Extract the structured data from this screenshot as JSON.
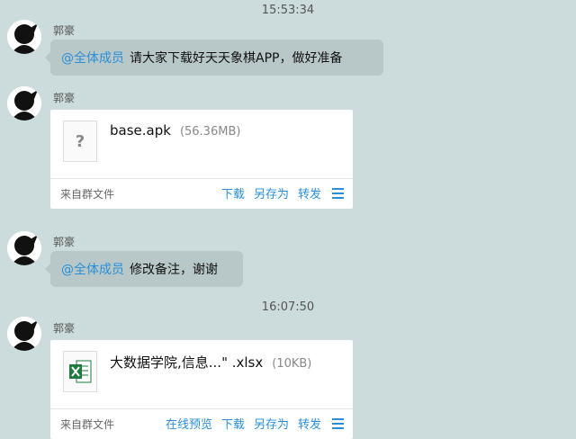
{
  "timestamps": [
    "15:53:34",
    "16:07:50"
  ],
  "messages": [
    {
      "sender": "郭豪",
      "mention": "@全体成员",
      "text": "请大家下载好天天象棋APP，做好准备"
    },
    {
      "sender": "郭豪",
      "file": {
        "name": "base.apk",
        "size": "(56.36MB)",
        "source": "来自群文件",
        "actions": [
          "下载",
          "另存为",
          "转发"
        ],
        "icon": "unknown-file-icon"
      }
    },
    {
      "sender": "郭豪",
      "mention": "@全体成员",
      "text": "修改备注，谢谢"
    },
    {
      "sender": "郭豪",
      "file": {
        "name": "大数据学院,信息...\" .xlsx",
        "size": "(10KB)",
        "source": "来自群文件",
        "actions": [
          "在线预览",
          "下载",
          "另存为",
          "转发"
        ],
        "icon": "excel-file-icon"
      }
    }
  ],
  "colors": {
    "background": "#ccdcdc",
    "bubble": "#b8c7c7",
    "link": "#2a8fd8",
    "excel_green": "#1f7a3f"
  }
}
